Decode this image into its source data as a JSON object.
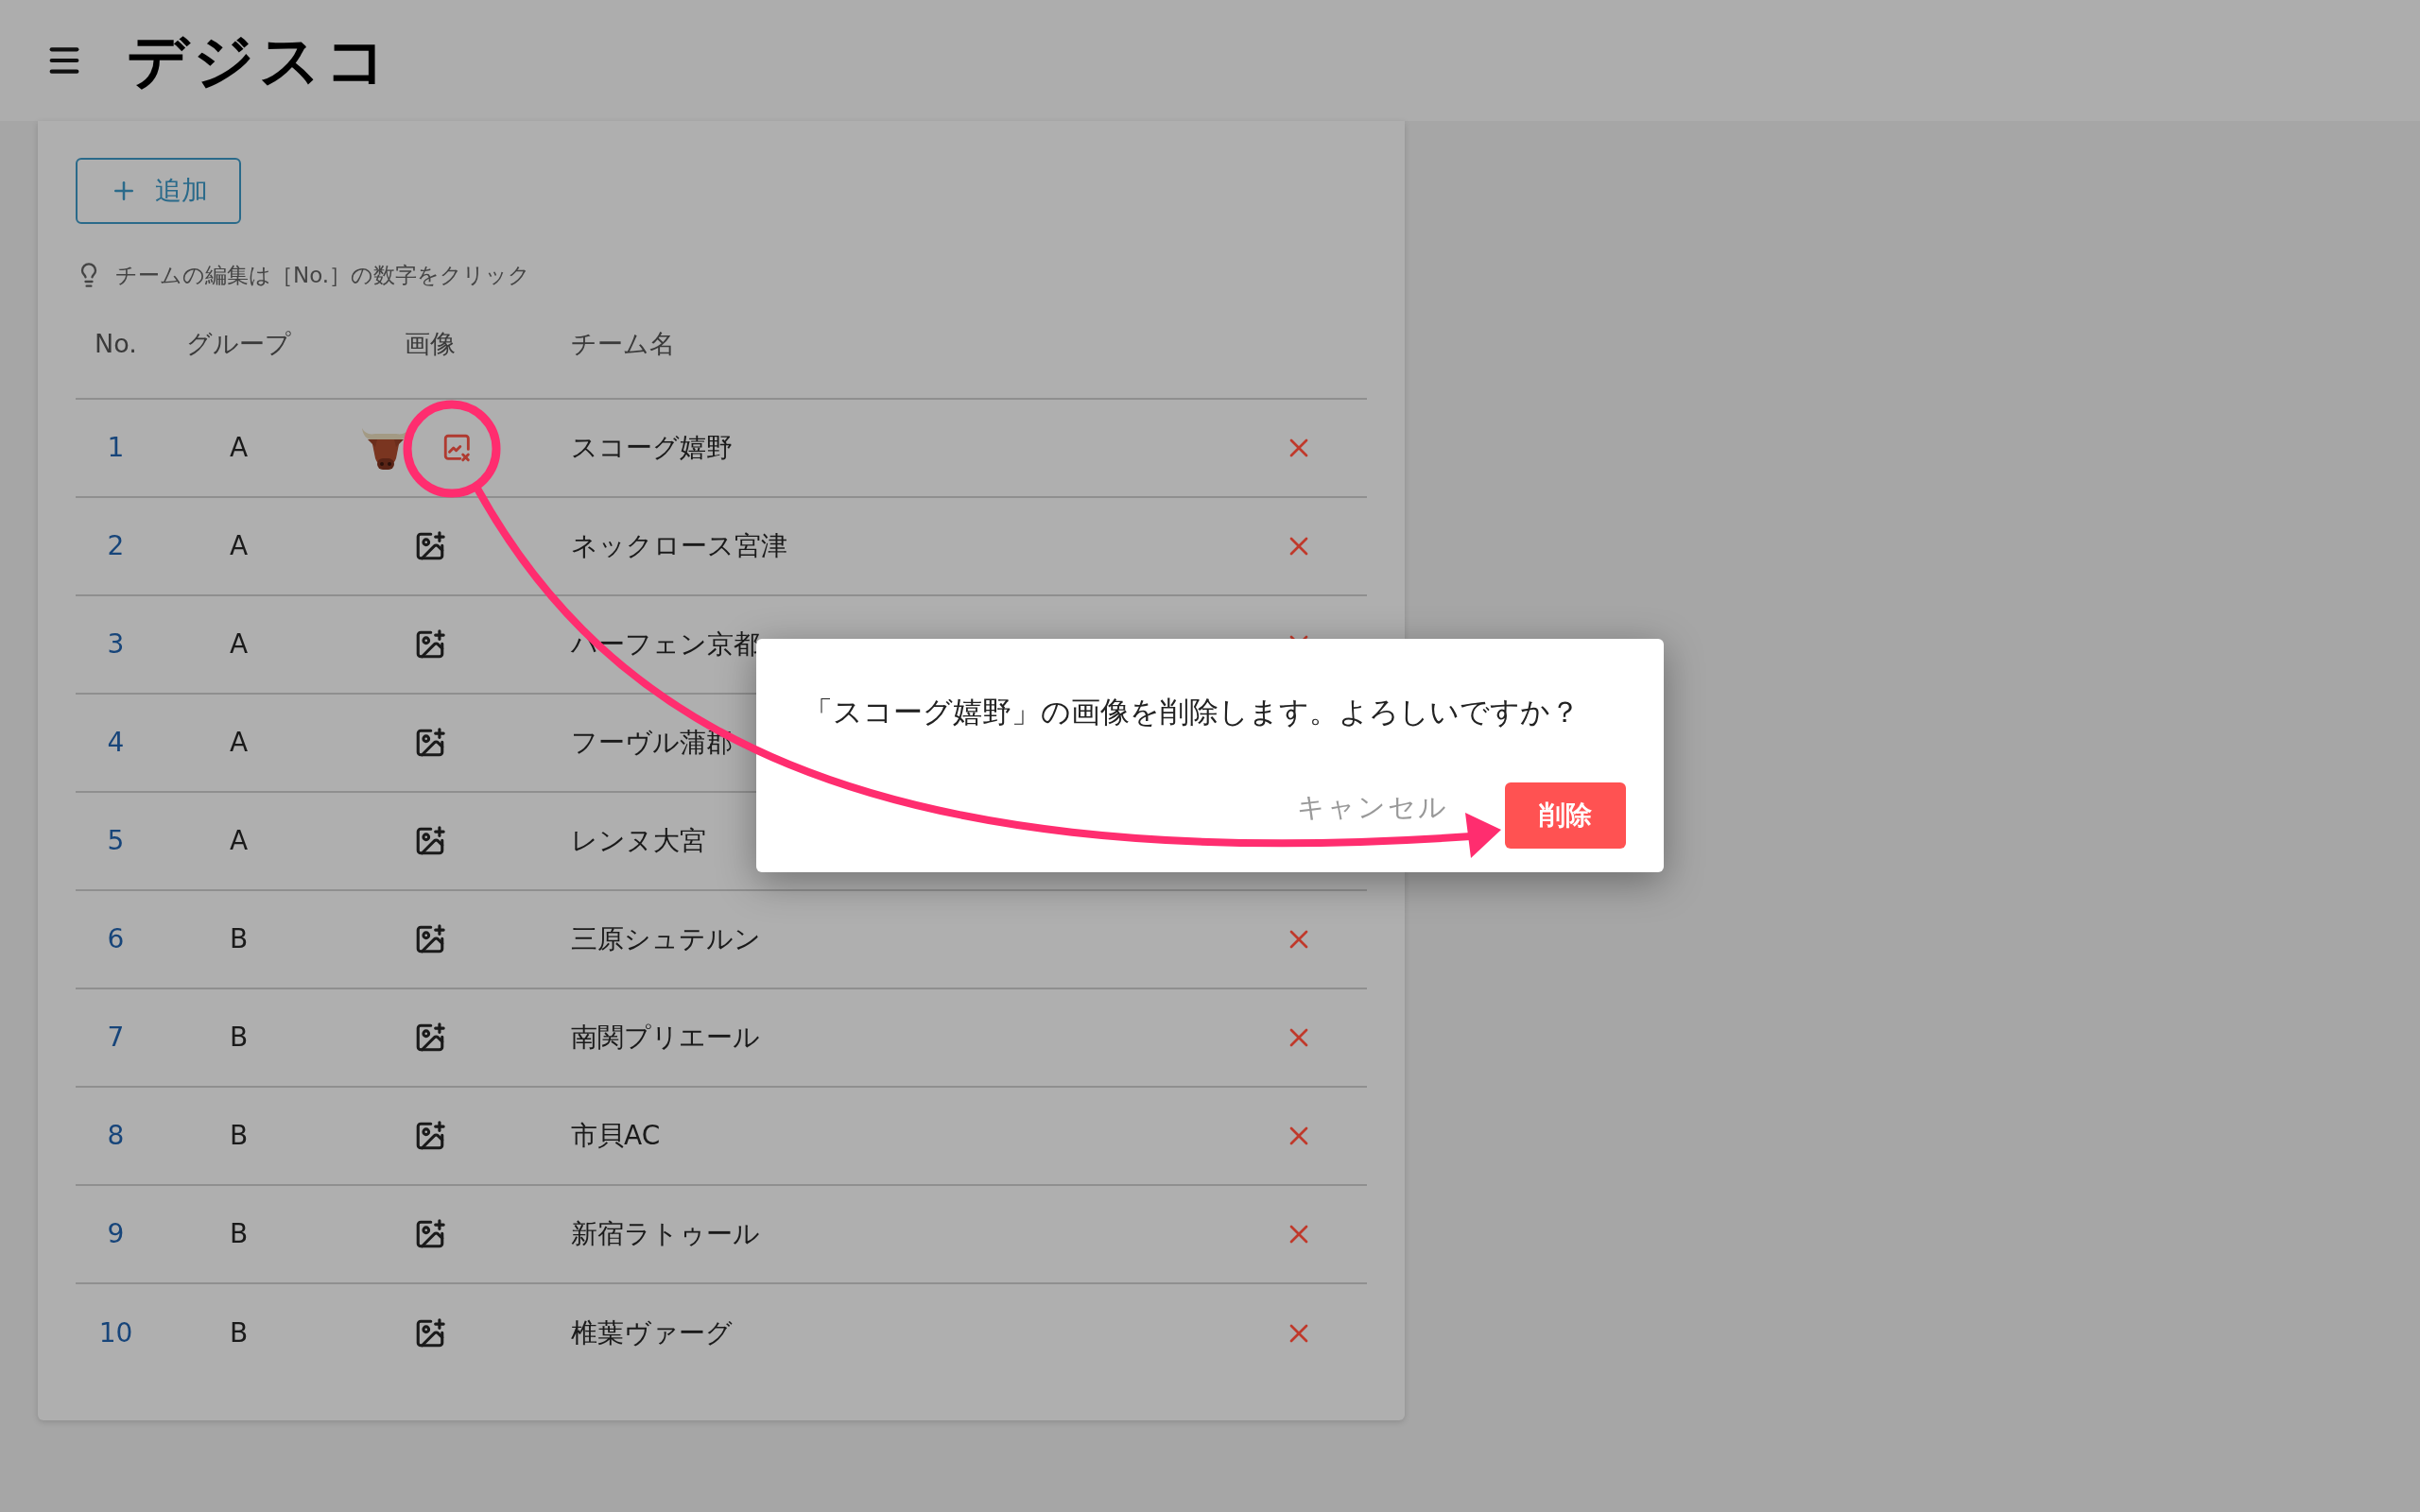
{
  "header": {
    "logo": "デジスコ"
  },
  "add_button": {
    "label": "追加"
  },
  "hint": "チームの編集は［No.］の数字をクリック",
  "table": {
    "columns": [
      "No.",
      "グループ",
      "画像",
      "チーム名"
    ],
    "rows": [
      {
        "no": "1",
        "group": "A",
        "has_image": true,
        "name": "スコーグ嬉野",
        "delete_visible": true
      },
      {
        "no": "2",
        "group": "A",
        "has_image": false,
        "name": "ネックロース宮津",
        "delete_visible": true
      },
      {
        "no": "3",
        "group": "A",
        "has_image": false,
        "name": "ハーフェン京都",
        "delete_visible": true
      },
      {
        "no": "4",
        "group": "A",
        "has_image": false,
        "name": "フーヴル蒲郡",
        "delete_visible": false
      },
      {
        "no": "5",
        "group": "A",
        "has_image": false,
        "name": "レンヌ大宮",
        "delete_visible": false
      },
      {
        "no": "6",
        "group": "B",
        "has_image": false,
        "name": "三原シュテルン",
        "delete_visible": true
      },
      {
        "no": "7",
        "group": "B",
        "has_image": false,
        "name": "南関プリエール",
        "delete_visible": true
      },
      {
        "no": "8",
        "group": "B",
        "has_image": false,
        "name": "市貝AC",
        "delete_visible": true
      },
      {
        "no": "9",
        "group": "B",
        "has_image": false,
        "name": "新宿ラトゥール",
        "delete_visible": true
      },
      {
        "no": "10",
        "group": "B",
        "has_image": false,
        "name": "椎葉ヴァーグ",
        "delete_visible": true
      }
    ]
  },
  "dialog": {
    "message": "「スコーグ嬉野」の画像を削除します。よろしいですか？",
    "cancel": "キャンセル",
    "confirm": "削除"
  }
}
